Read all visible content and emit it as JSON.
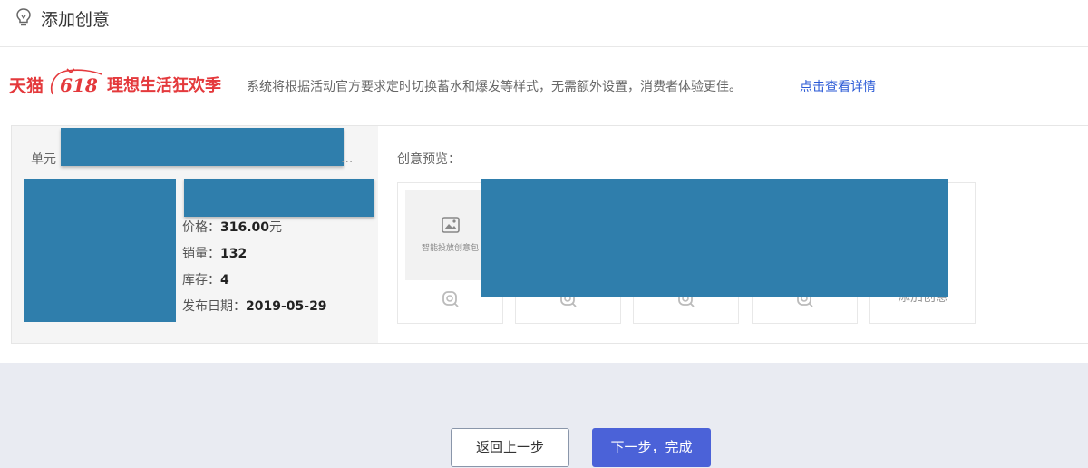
{
  "header": {
    "title": "添加创意",
    "icon": "lightbulb-icon"
  },
  "promo": {
    "logo_brand": "天猫",
    "logo_number": "618",
    "logo_slogan": "理想生活狂欢季",
    "description": "系统将根据活动官方要求定时切换蓄水和爆发等样式，无需额外设置，消费者体验更佳。",
    "link": "点击查看详情",
    "colors": {
      "brand": "#e4393c",
      "link": "#2b5ad6"
    }
  },
  "unit": {
    "label": "单元",
    "ellipsis": "..."
  },
  "product": {
    "price_label": "价格：",
    "price_value": "316.00",
    "price_unit": "元",
    "sales_label": "销量：",
    "sales_value": "132",
    "stock_label": "库存：",
    "stock_value": "4",
    "date_label": "发布日期：",
    "date_value": "2019-05-29"
  },
  "preview": {
    "label": "创意预览：",
    "first_caption": "智能投放创意包",
    "add_label": "添加创意"
  },
  "footer": {
    "back_label": "返回上一步",
    "next_label": "下一步，完成",
    "colors": {
      "primary": "#4b62d8",
      "background": "#e9ebf2"
    }
  },
  "redaction_color": "#2f7eac"
}
